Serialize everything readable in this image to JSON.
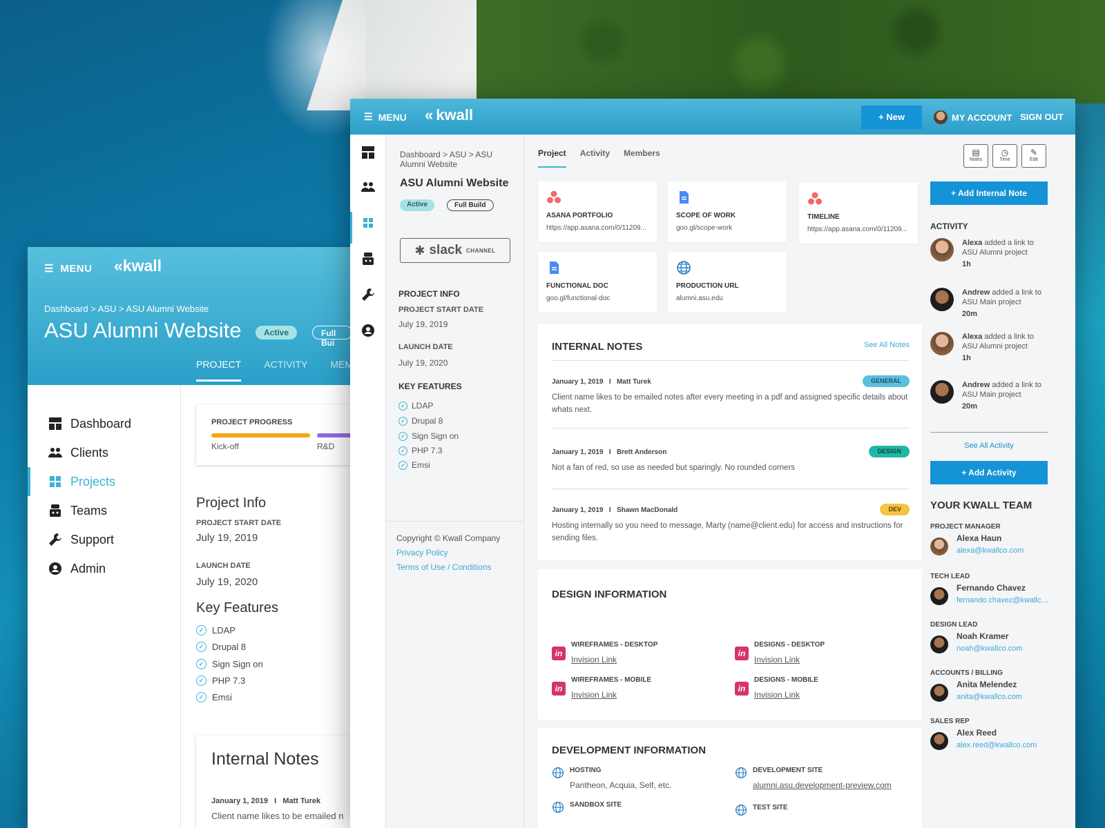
{
  "brand": {
    "menu_label": "MENU",
    "logo_text": "kwall",
    "accent": "#38b4d4",
    "primary_button": "#1493d6"
  },
  "back_window": {
    "breadcrumb": "Dashboard  >  ASU  >  ASU Alumni Website",
    "title": "ASU Alumni Website",
    "badges": [
      "Active",
      "Full Bui"
    ],
    "tabs": [
      "PROJECT",
      "ACTIVITY",
      "MEM"
    ],
    "sidebar": [
      {
        "label": "Dashboard",
        "icon": "dashboard-icon"
      },
      {
        "label": "Clients",
        "icon": "clients-icon"
      },
      {
        "label": "Projects",
        "icon": "projects-icon",
        "active": true
      },
      {
        "label": "Teams",
        "icon": "teams-icon"
      },
      {
        "label": "Support",
        "icon": "wrench-icon"
      },
      {
        "label": "Admin",
        "icon": "admin-icon"
      }
    ],
    "progress": {
      "label": "PROJECT PROGRESS",
      "stages": [
        "Kick-off",
        "R&D"
      ]
    },
    "project_info": {
      "heading": "Project Info",
      "start_label": "PROJECT START DATE",
      "start_value": "July 19, 2019",
      "launch_label": "LAUNCH DATE",
      "launch_value": "July 19, 2020"
    },
    "features_heading": "Key Features",
    "features": [
      "LDAP",
      "Drupal 8",
      "Sign Sign on",
      "PHP 7.3",
      "Emsi"
    ],
    "notes_heading": "Internal Notes",
    "note_meta": "January 1, 2019   I   Matt Turek",
    "note_text": "Client name likes to be emailed n"
  },
  "front_window": {
    "header": {
      "new_button": "+ New",
      "account": "MY ACCOUNT",
      "sign_out": "SIGN OUT"
    },
    "left_panel": {
      "breadcrumb": "Dashboard  >  ASU  >  ASU Alumni Website",
      "title": "ASU Alumni Website",
      "badge_active": "Active",
      "badge_build": "Full Build",
      "slack_text": "slack",
      "slack_channel": "CHANNEL",
      "info_heading": "PROJECT INFO",
      "start_label": "PROJECT START DATE",
      "start_value": "July 19, 2019",
      "launch_label": "LAUNCH DATE",
      "launch_value": "July 19, 2020",
      "features_heading": "KEY FEATURES",
      "features": [
        "LDAP",
        "Drupal 8",
        "Sign Sign on",
        "PHP 7.3",
        "Emsi"
      ],
      "copyright": "Copyright © Kwall Company",
      "privacy": "Privacy Policy",
      "terms": "Terms of Use / Conditions"
    },
    "tabs": [
      "Project",
      "Activity",
      "Members"
    ],
    "tools": [
      {
        "label": "Notes",
        "icon": "notes-icon"
      },
      {
        "label": "Time",
        "icon": "time-icon"
      },
      {
        "label": "Edit",
        "icon": "edit-icon"
      }
    ],
    "links": [
      {
        "name": "ASANA PORTFOLIO",
        "url": "https://app.asana.com/0/11209...",
        "icon": "asana-icon"
      },
      {
        "name": "SCOPE OF WORK",
        "url": "goo.gl/scope-work",
        "icon": "doc-icon"
      },
      {
        "name": "TIMELINE",
        "url": "https://app.asana.com/0/11209...",
        "icon": "asana-icon"
      },
      {
        "name": "FUNCTIONAL DOC",
        "url": "goo.gl/functional-doc",
        "icon": "doc-icon"
      },
      {
        "name": "PRODUCTION URL",
        "url": "alumni.asu.edu",
        "icon": "globe-icon"
      }
    ],
    "internal_notes": {
      "heading": "INTERNAL NOTES",
      "see_all": "See All Notes",
      "items": [
        {
          "meta": "January 1, 2019   I   Matt Turek",
          "tag": "GENERAL",
          "tag_color": "#5bc0de",
          "text": "Client name likes to be emailed notes after every meeting in a pdf and assigned specific details about whats next."
        },
        {
          "meta": "January 1, 2019   I   Brett Anderson",
          "tag": "DESIGN",
          "tag_color": "#1eb8a6",
          "text": "Not a fan of red, so use as needed but sparingly. No rounded corners"
        },
        {
          "meta": "January 1, 2019   I   Shawn MacDonald",
          "tag": "DEV",
          "tag_color": "#f6c344",
          "text": "Hosting internally so you need to message, Marty (name@client.edu) for access and instructions for sending files."
        }
      ]
    },
    "design_info": {
      "heading": "DESIGN INFORMATION",
      "items": [
        {
          "title": "WIREFRAMES - DESKTOP",
          "link": "Invision Link"
        },
        {
          "title": "DESIGNS - DESKTOP",
          "link": "Invision Link"
        },
        {
          "title": "WIREFRAMES - MOBILE",
          "link": "Invision Link"
        },
        {
          "title": "DESIGNS - MOBILE",
          "link": "Invision Link"
        }
      ]
    },
    "dev_info": {
      "heading": "DEVELOPMENT INFORMATION",
      "items": [
        {
          "title": "HOSTING",
          "value": "Pantheon, Acquia, Self, etc."
        },
        {
          "title": "DEVELOPMENT SITE",
          "value": "alumni.asu.development-preview.com"
        },
        {
          "title": "SANDBOX SITE",
          "value": ""
        },
        {
          "title": "TEST SITE",
          "value": ""
        }
      ]
    },
    "right_panel": {
      "add_note": "+ Add Internal Note",
      "activity_heading": "ACTIVITY",
      "activity": [
        {
          "name": "Alexa",
          "text": " added a link to ASU Alumni project",
          "time": "1h"
        },
        {
          "name": "Andrew",
          "text": " added a link to ASU Main project",
          "time": "20m"
        },
        {
          "name": "Alexa",
          "text": " added a link to ASU Alumni project",
          "time": "1h"
        },
        {
          "name": "Andrew",
          "text": " added a link to ASU Main project",
          "time": "20m"
        }
      ],
      "see_all_activity": "See All Activity",
      "add_activity": "+ Add Activity",
      "team_heading": "YOUR KWALL TEAM",
      "team": [
        {
          "role": "PROJECT MANAGER",
          "name": "Alexa Haun",
          "email": "alexa@kwallco.com"
        },
        {
          "role": "TECH LEAD",
          "name": "Fernando Chavez",
          "email": "fernando.chavez@kwallco.com"
        },
        {
          "role": "DESIGN LEAD",
          "name": "Noah Kramer",
          "email": "noah@kwallco.com"
        },
        {
          "role": "ACCOUNTS / BILLING",
          "name": "Anita Melendez",
          "email": "anita@kwallco.com"
        },
        {
          "role": "SALES REP",
          "name": "Alex Reed",
          "email": "alex.reed@kwallco.com"
        }
      ]
    }
  }
}
